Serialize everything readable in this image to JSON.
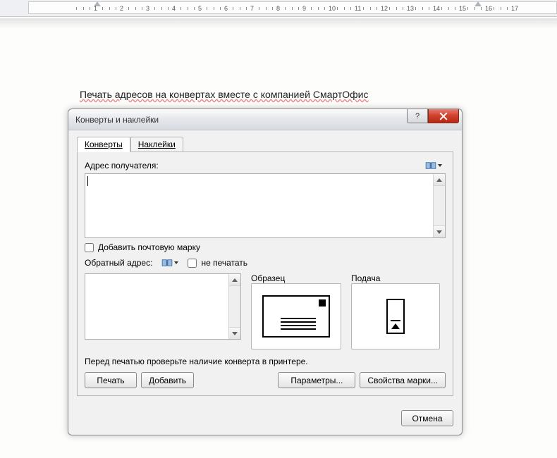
{
  "ruler": {
    "ticks": [
      "1",
      "2",
      "3",
      "4",
      "5",
      "6",
      "7",
      "8",
      "9",
      "10",
      "11",
      "12",
      "13",
      "14",
      "15",
      "16",
      "17"
    ]
  },
  "document": {
    "line1": "Печать адресов на конвертах вместе с компанией СмартОфис"
  },
  "dialog": {
    "title": "Конверты и наклейки",
    "tabs": {
      "envelopes": "Конверты",
      "labels": "Наклейки",
      "active": 0
    },
    "recipient": {
      "label": "Адрес получателя:",
      "value": ""
    },
    "add_stamp": "Добавить почтовую марку",
    "return_address": {
      "label": "Обратный адрес:",
      "no_print": "не печатать",
      "value": ""
    },
    "sample": {
      "label": "Образец"
    },
    "feed": {
      "label": "Подача"
    },
    "hint": "Перед печатью проверьте наличие конверта в принтере.",
    "buttons": {
      "print": "Печать",
      "add": "Добавить",
      "options": "Параметры...",
      "stamp_props": "Свойства марки...",
      "cancel": "Отмена"
    }
  }
}
